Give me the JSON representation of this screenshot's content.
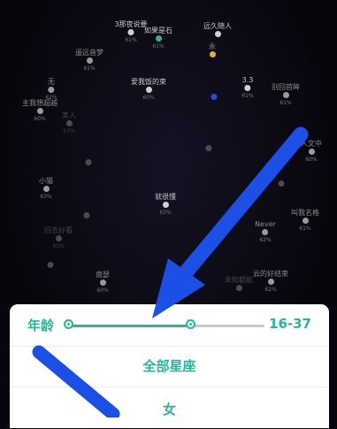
{
  "background_users": [
    {
      "name": "3那夜说要",
      "pct": "61%"
    },
    {
      "name": "如果是石",
      "pct": "61%"
    },
    {
      "name": "远久随人",
      "pct": ""
    },
    {
      "name": "遥远音梦",
      "pct": "61%"
    },
    {
      "name": "无",
      "pct": "62%"
    },
    {
      "name": "永",
      "pct": ""
    },
    {
      "name": "爱我饭的束",
      "pct": "60%"
    },
    {
      "name": "3.3",
      "pct": "61%"
    },
    {
      "name": "别回首眸",
      "pct": "61%"
    },
    {
      "name": "主我想超越",
      "pct": "60%"
    },
    {
      "name": "某人",
      "pct": "63%"
    },
    {
      "name": "人文中",
      "pct": "60%"
    },
    {
      "name": "小猫",
      "pct": "63%"
    },
    {
      "name": "叫我名格",
      "pct": "61%"
    },
    {
      "name": "就很懂",
      "pct": "63%"
    },
    {
      "name": "Never",
      "pct": "62%"
    },
    {
      "name": "回去好看",
      "pct": "60%"
    },
    {
      "name": "南瑟",
      "pct": "60%"
    },
    {
      "name": "云的好结束",
      "pct": "62%"
    },
    {
      "name": "未知都能",
      "pct": "61%"
    }
  ],
  "filter_sheet": {
    "age_label": "年龄",
    "age_range_text": "16-37",
    "age_slider": {
      "min_fraction": 0.0,
      "max_fraction": 0.62
    },
    "zodiac_option": "全部星座",
    "gender_option": "女"
  },
  "colors": {
    "accent": "#2ab59a",
    "arrow": "#1b4fe6"
  }
}
